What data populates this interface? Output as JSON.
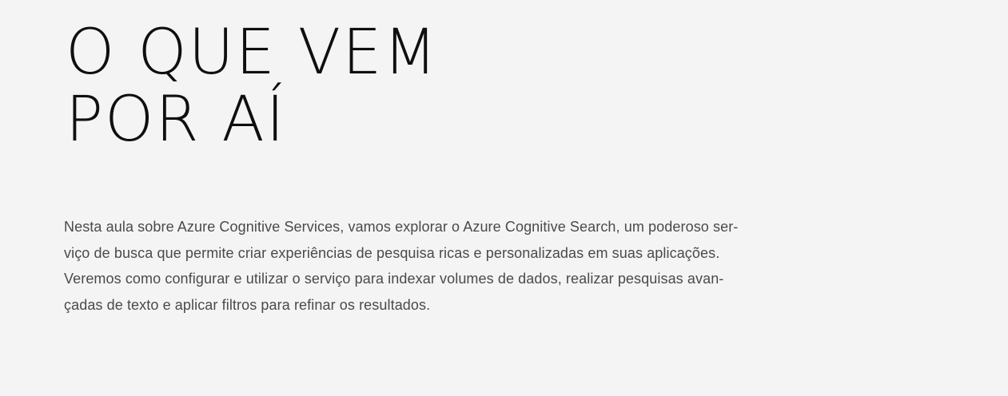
{
  "header": {
    "title_lines": [
      "O QUE VEM",
      "POR AÍ"
    ]
  },
  "content": {
    "paragraph_lines": [
      "Nesta aula sobre Azure Cognitive Services, vamos explorar o Azure Cognitive Search, um poderoso ser-",
      "viço de busca que permite criar experiências de pesquisa ricas e personalizadas em suas aplicações.",
      "Veremos como configurar e utilizar o serviço para indexar volumes de dados, realizar pesquisas avan-",
      "çadas de texto e aplicar filtros para refinar os resultados."
    ]
  },
  "colors": {
    "background": "#f4f4f4",
    "title": "#0f0f0f",
    "body": "#4a4a4a"
  }
}
